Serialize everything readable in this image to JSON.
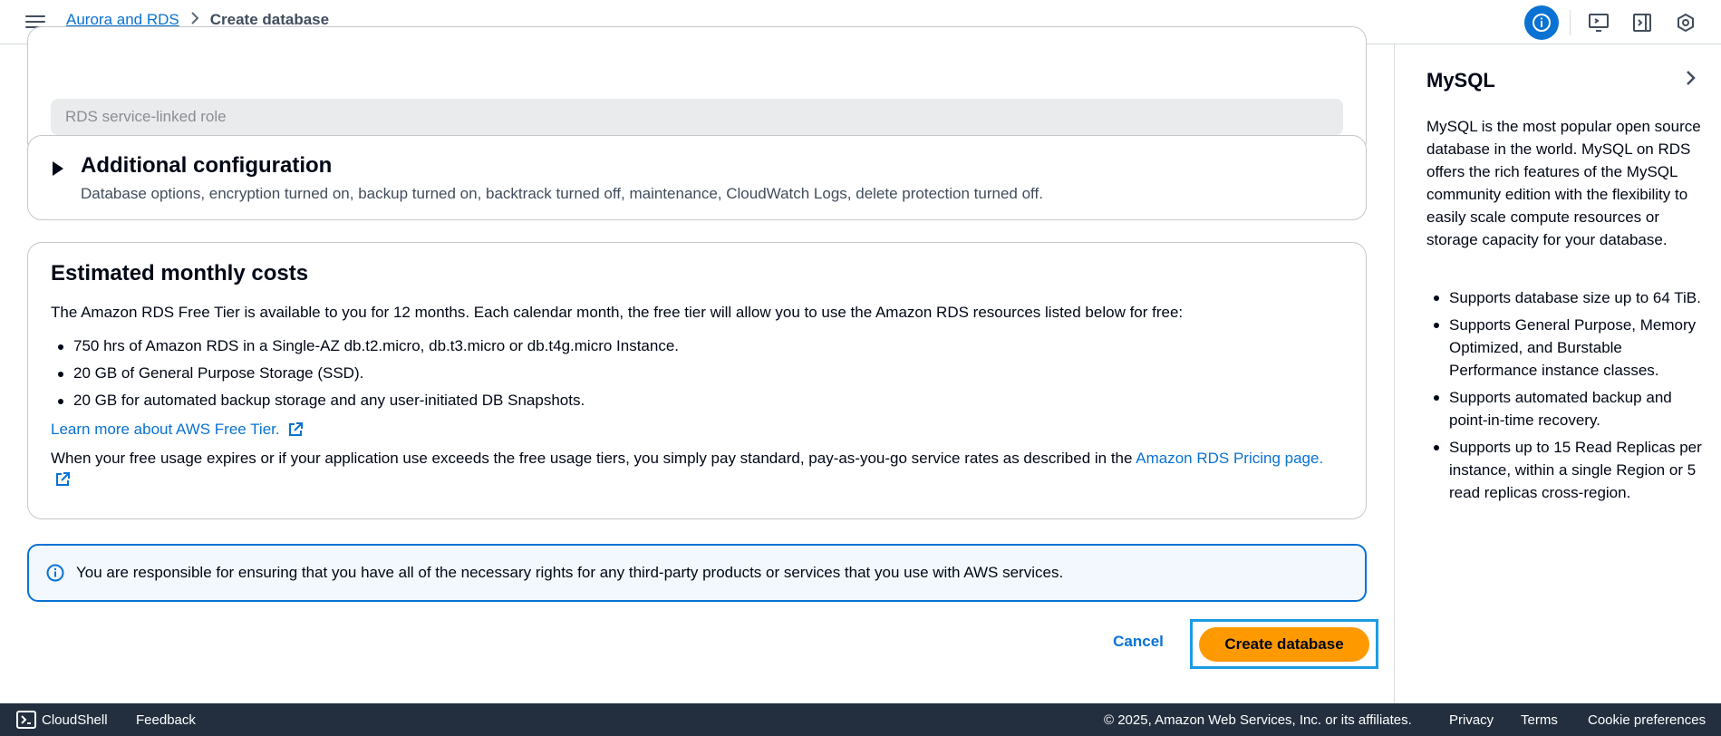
{
  "breadcrumb": {
    "parent": "Aurora and RDS",
    "current": "Create database"
  },
  "role_field": {
    "value": "RDS service-linked role"
  },
  "additional": {
    "title": "Additional configuration",
    "description": "Database options, encryption turned on, backup turned on, backtrack turned off, maintenance, CloudWatch Logs, delete protection turned off."
  },
  "costs": {
    "title": "Estimated monthly costs",
    "intro": "The Amazon RDS Free Tier is available to you for 12 months. Each calendar month, the free tier will allow you to use the Amazon RDS resources listed below for free:",
    "items": [
      "750 hrs of Amazon RDS in a Single-AZ db.t2.micro, db.t3.micro or db.t4g.micro Instance.",
      "20 GB of General Purpose Storage (SSD).",
      "20 GB for automated backup storage and any user-initiated DB Snapshots."
    ],
    "learn_more": "Learn more about AWS Free Tier.",
    "pricing_text": "When your free usage expires or if your application use exceeds the free usage tiers, you simply pay standard, pay-as-you-go service rates as described in the",
    "pricing_link": "Amazon RDS Pricing page."
  },
  "alert": {
    "text": "You are responsible for ensuring that you have all of the necessary rights for any third-party products or services that you use with AWS services."
  },
  "actions": {
    "cancel": "Cancel",
    "create": "Create database"
  },
  "help_panel": {
    "title": "MySQL",
    "body": "MySQL is the most popular open source database in the world. MySQL on RDS offers the rich features of the MySQL community edition with the flexibility to easily scale compute resources or storage capacity for your database.",
    "items": [
      "Supports database size up to 64 TiB.",
      "Supports General Purpose, Memory Optimized, and Burstable Performance instance classes.",
      "Supports automated backup and point-in-time recovery.",
      "Supports up to 15 Read Replicas per instance, within a single Region or 5 read replicas cross-region."
    ]
  },
  "footer": {
    "cloudshell": "CloudShell",
    "feedback": "Feedback",
    "copyright": "© 2025, Amazon Web Services, Inc. or its affiliates.",
    "privacy": "Privacy",
    "terms": "Terms",
    "cookies": "Cookie preferences"
  },
  "colors": {
    "link": "#0972d3",
    "primary_button": "#ff9900",
    "footer_bg": "#232f3e",
    "alert_bg": "#f2f8fd"
  },
  "icons": [
    "menu-icon",
    "chevron-right-icon",
    "info-icon",
    "feedback-screen-icon",
    "panel-icon",
    "settings-hex-icon",
    "caret-right-icon",
    "external-link-icon",
    "cloudshell-icon"
  ]
}
